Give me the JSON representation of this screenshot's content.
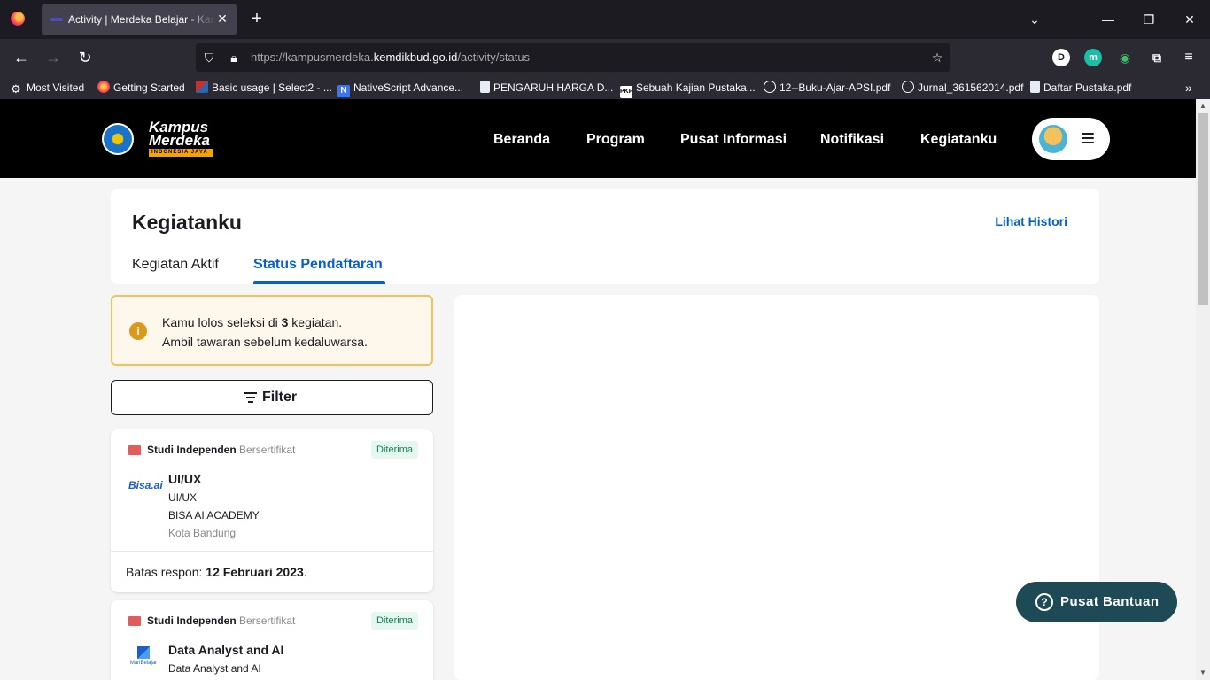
{
  "browser": {
    "tab_title": "Activity | Merdeka Belajar - Kampus Merdeka",
    "url_prefix": "https://kampusmerdeka.",
    "url_domain": "kemdikbud.go.id",
    "url_path": "/activity/status",
    "new_tab": "+",
    "close_tab": "✕",
    "bookmarks": [
      {
        "label": "Most Visited",
        "icon": "gear-icon"
      },
      {
        "label": "Getting Started",
        "icon": "firefox-icon"
      },
      {
        "label": "Basic usage | Select2 - ...",
        "icon": "select2-icon"
      },
      {
        "label": "NativeScript Advance...",
        "icon": "nativescript-icon"
      },
      {
        "label": "PENGARUH HARGA D...",
        "icon": "document-icon"
      },
      {
        "label": "Sebuah Kajian Pustaka...",
        "icon": "pkp-icon"
      },
      {
        "label": "12--Buku-Ajar-APSI.pdf",
        "icon": "globe-icon"
      },
      {
        "label": "Jurnal_361562014.pdf",
        "icon": "globe-icon"
      },
      {
        "label": "Daftar Pustaka.pdf",
        "icon": "document-icon"
      }
    ],
    "extensions": [
      {
        "label": "D",
        "icon": "dashlane-icon"
      },
      {
        "label": "m",
        "icon": "mendeley-icon"
      }
    ]
  },
  "site": {
    "logo_line1": "Kampus",
    "logo_line2": "Merdeka",
    "logo_tagline": "INDONESIA JAYA",
    "nav": [
      "Beranda",
      "Program",
      "Pusat Informasi",
      "Notifikasi",
      "Kegiatanku"
    ]
  },
  "page": {
    "title": "Kegiatanku",
    "history_link": "Lihat Histori",
    "tabs": [
      {
        "label": "Kegiatan Aktif",
        "active": false
      },
      {
        "label": "Status Pendaftaran",
        "active": true
      }
    ],
    "alert": {
      "pre": "Kamu lolos seleksi di ",
      "count": "3",
      "post": " kegiatan.",
      "line2": "Ambil tawaran sebelum kedaluwarsa."
    },
    "filter_label": "Filter",
    "cards": [
      {
        "program": "Studi Independen",
        "cert": "Bersertifikat",
        "status": "Diterima",
        "logo": "Bisa.ai",
        "title": "UI/UX",
        "subtitle": "UI/UX",
        "company": "BISA AI ACADEMY",
        "location": "Kota Bandung",
        "deadline_label": "Batas respon: ",
        "deadline_date": "12 Februari 2023",
        "deadline_end": "."
      },
      {
        "program": "Studi Independen",
        "cert": "Bersertifikat",
        "status": "Diterima",
        "logo": "MariBelajar",
        "title": "Data Analyst and AI",
        "subtitle": "Data Analyst and AI"
      }
    ],
    "help_label": "Pusat Bantuan"
  }
}
